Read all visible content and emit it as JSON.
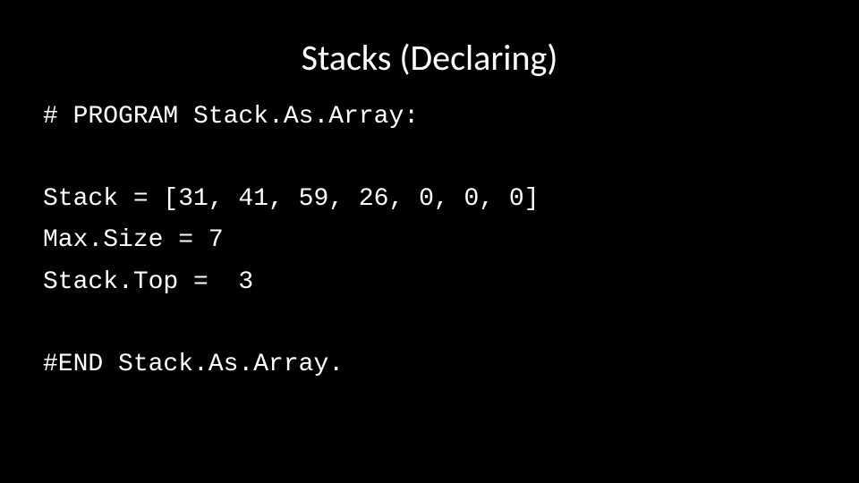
{
  "title": "Stacks (Declaring)",
  "code": {
    "l1": "# PROGRAM Stack.As.Array:",
    "l2": "Stack = [31, 41, 59, 26, 0, 0, 0]",
    "l3": "Max.Size = 7",
    "l4": "Stack.Top =  3",
    "l5": "#END Stack.As.Array."
  }
}
